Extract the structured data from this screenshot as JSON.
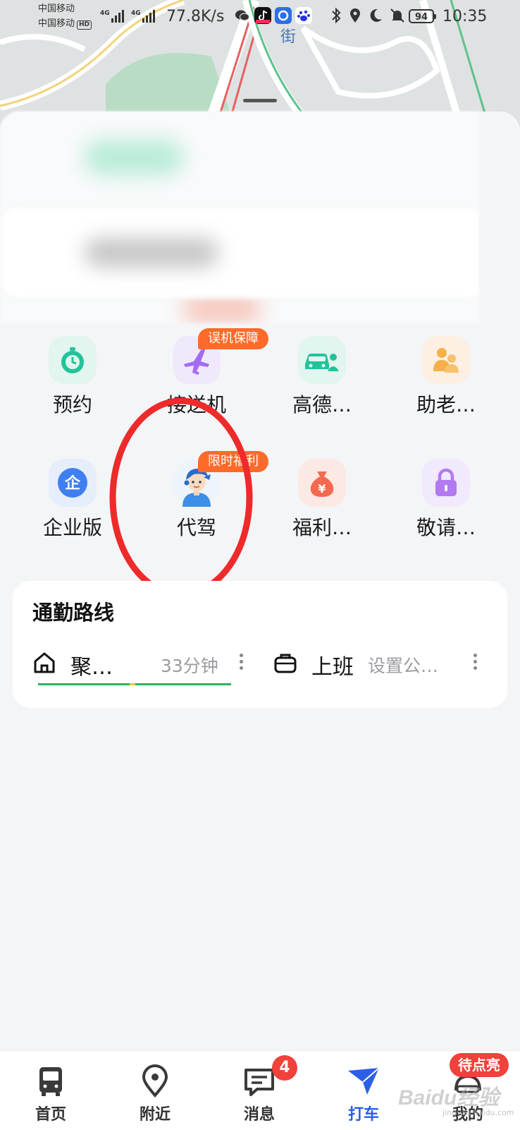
{
  "status_bar": {
    "carrier_1": "中国移动",
    "carrier_2": "中国移动",
    "hd_label": "HD",
    "network_type": "4G",
    "net_speed": "77.8K/s",
    "battery": "94",
    "time": "10:35"
  },
  "map": {
    "street_label": "街"
  },
  "services": [
    {
      "label": "预约",
      "icon": "clock-icon",
      "badge": ""
    },
    {
      "label": "接送机",
      "icon": "plane-icon",
      "badge": "误机保障"
    },
    {
      "label": "高德…",
      "icon": "car-people-icon",
      "badge": ""
    },
    {
      "label": "助老…",
      "icon": "elderly-icon",
      "badge": ""
    },
    {
      "label": "企业版",
      "icon": "enterprise-icon",
      "badge": ""
    },
    {
      "label": "代驾",
      "icon": "driver-avatar-icon",
      "badge": "限时福利"
    },
    {
      "label": "福利…",
      "icon": "money-bag-icon",
      "badge": ""
    },
    {
      "label": "敬请…",
      "icon": "lock-icon",
      "badge": ""
    }
  ],
  "commute": {
    "title": "通勤路线",
    "home_route": {
      "name": "聚…",
      "eta": "33分钟"
    },
    "work_route": {
      "name": "上班",
      "hint": "设置公…"
    }
  },
  "bottom_nav": {
    "items": [
      {
        "label": "首页",
        "icon": "bus-icon"
      },
      {
        "label": "附近",
        "icon": "location-pin-icon"
      },
      {
        "label": "消息",
        "icon": "message-icon"
      },
      {
        "label": "打车",
        "icon": "taxi-arrow-icon"
      },
      {
        "label": "我的",
        "icon": "profile-icon"
      }
    ],
    "active": "打车",
    "message_count": "4",
    "profile_badge": "待点亮"
  },
  "watermark": {
    "main": "Baidu经验",
    "sub": "jingyan.baidu.com"
  },
  "colors": {
    "accent_blue": "#2b5fe6",
    "badge_orange": "#ff6a2a",
    "badge_red": "#f0413a",
    "annotation_red": "#ee2a2a",
    "teal": "#22c39a",
    "purple": "#a36bf0"
  }
}
